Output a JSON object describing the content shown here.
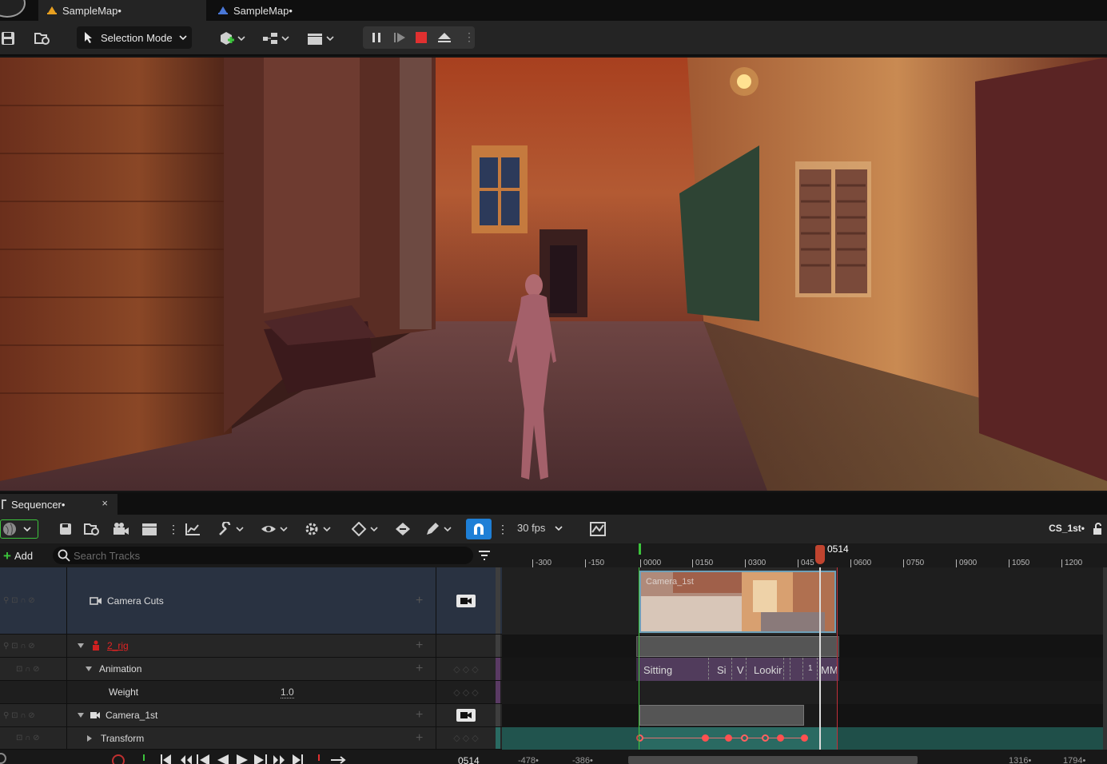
{
  "tabs": [
    {
      "label": "SampleMap•",
      "active": true
    },
    {
      "label": "SampleMap•",
      "active": false
    }
  ],
  "toolbar": {
    "selection_mode": "Selection Mode"
  },
  "sequencer": {
    "tab_label": "Sequencer•",
    "close_glyph": "×",
    "fps": "30 fps",
    "sequence_name": "CS_1st•",
    "add_label": "Add",
    "search_placeholder": "Search Tracks"
  },
  "ruler": {
    "playhead_time": "0514",
    "ticks": [
      "-300",
      "-150",
      "0000",
      "0150",
      "0300",
      "045",
      "0600",
      "0750",
      "0900",
      "1050",
      "1200"
    ]
  },
  "tracks": {
    "camera_cuts": "Camera Cuts",
    "rig": "2_rig",
    "animation": "Animation",
    "weight": "Weight",
    "weight_value": "1.0",
    "camera": "Camera_1st",
    "transform": "Transform"
  },
  "clips": {
    "camera_clip": "Camera_1st",
    "anim_sitting": "Sitting",
    "anim_si": "Si",
    "anim_v": "V",
    "anim_looking": "Lookir",
    "anim_1": "1",
    "anim_mm": "MM"
  },
  "transport": {
    "current_frame": "0514",
    "view_start": "-478•",
    "view_start2": "-386•",
    "view_end": "1316•",
    "view_end2": "1794•"
  },
  "colors": {
    "accent_blue": "#1e7fd6",
    "stop_red": "#e03030",
    "playhead": "#c0442f",
    "transform_track": "#2a6a62"
  }
}
